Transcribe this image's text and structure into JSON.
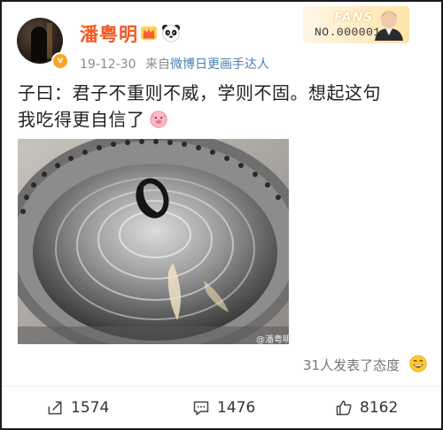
{
  "post": {
    "username": "潘粤明",
    "date": "19-12-30",
    "source_prefix": "来自",
    "source_app": "微博日更画手达人",
    "text_line1": "子曰：君子不重则不威，学则不固。想起这句",
    "text_line2": "我吃得更自信了",
    "watermark": "@潘粤明",
    "reactions_text": "31人发表了态度",
    "verified_badge": "v"
  },
  "fans_card": {
    "title": "FANS",
    "number": "NO.000001"
  },
  "actions": {
    "repost_count": "1574",
    "comment_count": "1476",
    "like_count": "8162"
  },
  "icons": {
    "crown": "crown-icon",
    "panda": "panda-icon",
    "pig": "pig-face-icon",
    "reaction": "grinning-emoji-icon",
    "repost": "share-arrow-icon",
    "comment": "comment-icon",
    "like": "thumbs-up-icon"
  },
  "colors": {
    "username": "#f15a22",
    "source_link": "#4a7fb5",
    "verified_badge": "#f6a623"
  }
}
